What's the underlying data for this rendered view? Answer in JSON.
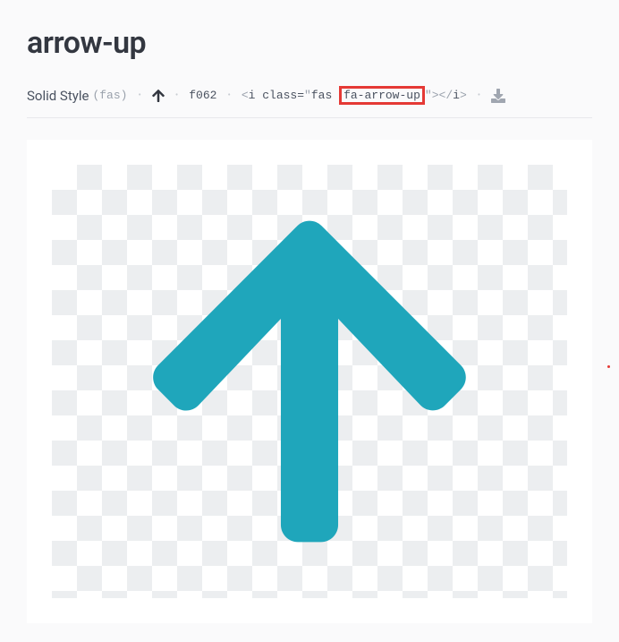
{
  "title": "arrow-up",
  "meta": {
    "style_name": "Solid Style",
    "style_abbrev": "(fas)",
    "unicode": "f062",
    "snippet": {
      "open_lt": "<",
      "tag_open": "i class=",
      "quote1": "\"",
      "prefix": "fas ",
      "class_name": "fa-arrow-up",
      "quote2": "\"",
      "close_gt": ">",
      "end_open": "</",
      "end_tag": "i",
      "end_close": ">"
    }
  },
  "colors": {
    "arrow": "#1fa6bb",
    "highlight": "#e53935"
  }
}
